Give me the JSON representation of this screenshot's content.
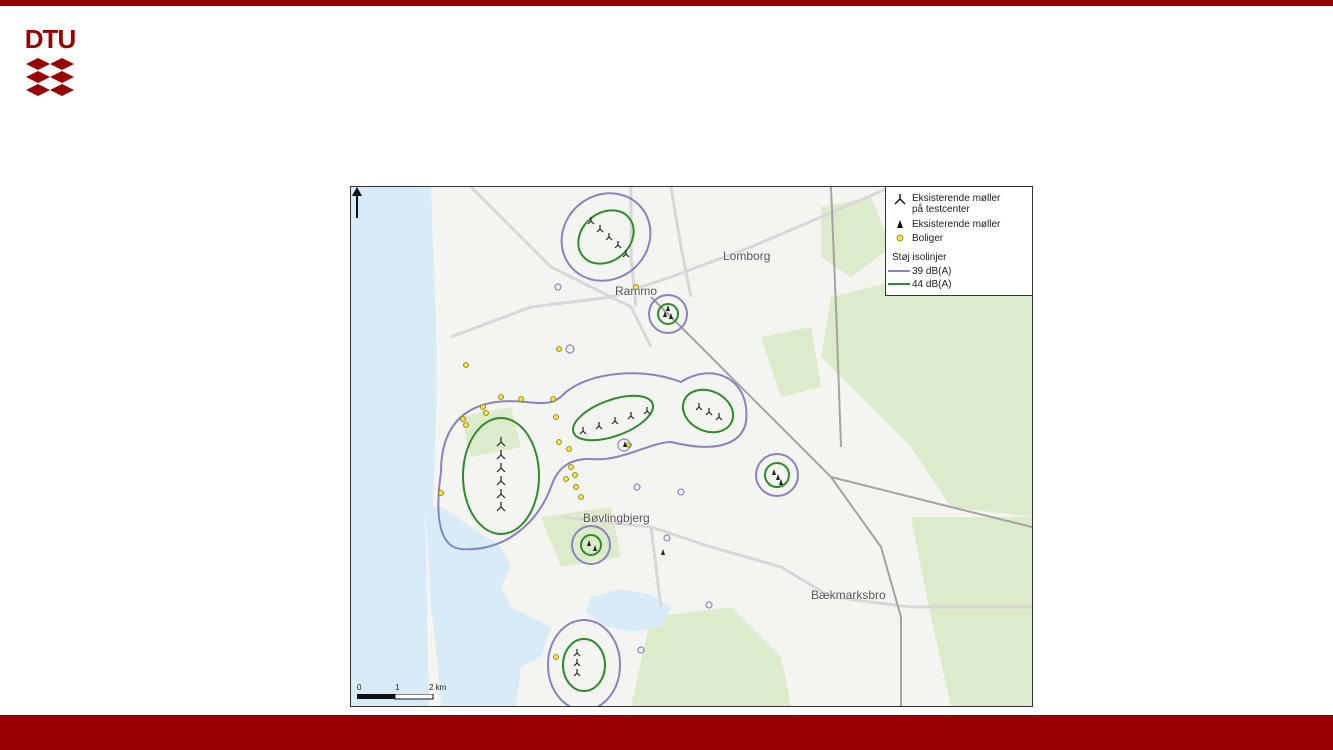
{
  "header": {
    "logo_text": "DTU"
  },
  "colors": {
    "brand": "#990000",
    "sea": "#d7ecf7",
    "land": "#f4f4f1",
    "forest": "#dcebc9",
    "road": "#d7d7d7",
    "rail": "#a3a3a3",
    "contour_39": "#8a83c2",
    "contour_44": "#2e8b2e",
    "housing": "#f4e24a"
  },
  "map": {
    "place_labels": {
      "lomborg": "Lomborg",
      "rammo": "Rammo",
      "bovlingbjerg": "Bøvlingbjerg",
      "baekmarksbro": "Bækmarksbro"
    },
    "legend": {
      "items": [
        {
          "icon": "large-turbine-icon",
          "label": "Eksisterende møller\npå testcenter"
        },
        {
          "icon": "small-turbine-icon",
          "label": "Eksisterende møller"
        },
        {
          "icon": "housing-dot-icon",
          "label": "Boliger"
        }
      ],
      "contour_heading": "Støj isolinjer",
      "contours": [
        {
          "icon": "purple-line-icon",
          "label": "39 dB(A)"
        },
        {
          "icon": "green-line-icon",
          "label": "44 dB(A)"
        }
      ]
    },
    "scale": {
      "labels": [
        "0",
        "1",
        "2 km"
      ]
    }
  }
}
